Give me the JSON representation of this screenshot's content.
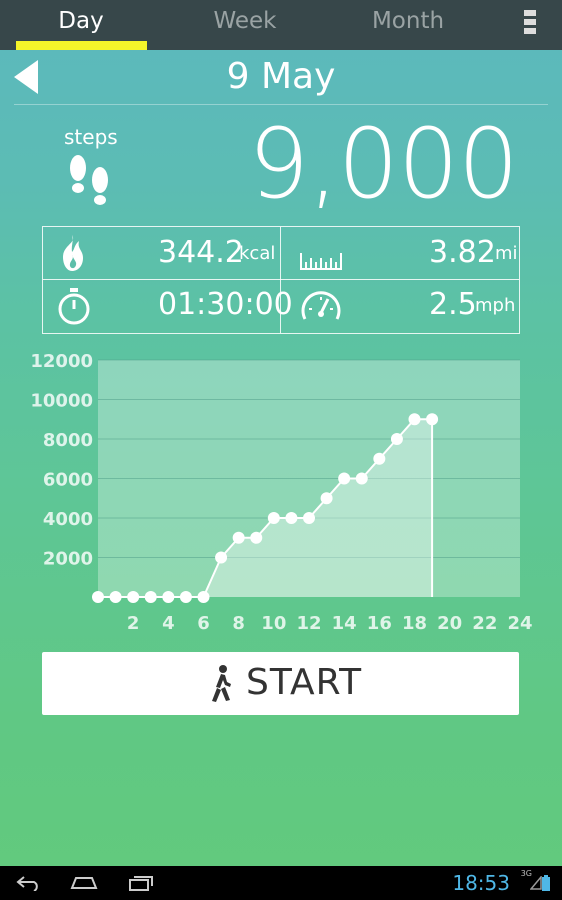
{
  "tabs": [
    {
      "label": "Day",
      "active": true
    },
    {
      "label": "Week",
      "active": false
    },
    {
      "label": "Month",
      "active": false
    }
  ],
  "date": "9 May",
  "steps": {
    "label": "steps",
    "value": "9,000"
  },
  "stats": {
    "calories": {
      "value": "344.2",
      "unit": "kcal"
    },
    "distance": {
      "value": "3.82",
      "unit": "mi"
    },
    "duration": {
      "value": "01:30:00"
    },
    "speed": {
      "value": "2.5",
      "unit": "mph"
    }
  },
  "start_button": {
    "label": "START"
  },
  "status": {
    "time": "18:53",
    "network": "3G"
  },
  "colors": {
    "accent_tab": "#f5f52a",
    "clock": "#4fb7e6"
  },
  "chart_data": {
    "type": "area",
    "x_ticks": [
      2,
      4,
      6,
      8,
      10,
      12,
      14,
      16,
      18,
      20,
      22,
      24
    ],
    "y_ticks": [
      2000,
      4000,
      6000,
      8000,
      10000,
      12000
    ],
    "xlim": [
      0,
      24
    ],
    "ylim": [
      0,
      12000
    ],
    "grid": true,
    "x": [
      0,
      1,
      2,
      3,
      4,
      5,
      6,
      7,
      8,
      9,
      10,
      11,
      12,
      13,
      14,
      15,
      16,
      17,
      18,
      19
    ],
    "values": [
      0,
      0,
      0,
      0,
      0,
      0,
      0,
      2000,
      3000,
      3000,
      4000,
      4000,
      4000,
      5000,
      6000,
      6000,
      7000,
      8000,
      9000,
      9000
    ]
  }
}
